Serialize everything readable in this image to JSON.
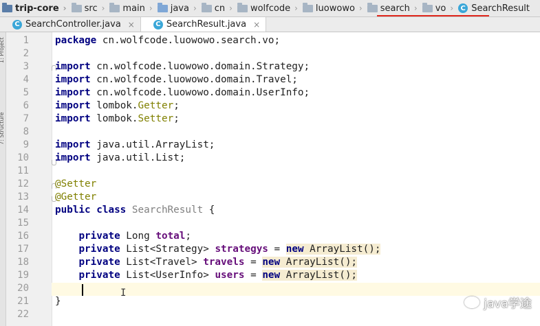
{
  "breadcrumb": {
    "items": [
      {
        "label": "trip-core",
        "icon": "project-folder-icon"
      },
      {
        "label": "src",
        "icon": "folder-icon"
      },
      {
        "label": "main",
        "icon": "folder-icon"
      },
      {
        "label": "java",
        "icon": "source-folder-icon"
      },
      {
        "label": "cn",
        "icon": "package-folder-icon"
      },
      {
        "label": "wolfcode",
        "icon": "package-folder-icon"
      },
      {
        "label": "luowowo",
        "icon": "package-folder-icon"
      },
      {
        "label": "search",
        "icon": "package-folder-icon"
      },
      {
        "label": "vo",
        "icon": "package-folder-icon"
      },
      {
        "label": "SearchResult",
        "icon": "class-icon"
      }
    ]
  },
  "tabs": [
    {
      "label": "SearchController.java",
      "icon": "class-icon",
      "close": "×",
      "active": false
    },
    {
      "label": "SearchResult.java",
      "icon": "class-icon",
      "close": "×",
      "active": true
    }
  ],
  "side_strip": {
    "project_label": "1: Project",
    "structure_label": "7: Structure"
  },
  "editor": {
    "line_numbers": [
      "1",
      "2",
      "3",
      "4",
      "5",
      "6",
      "7",
      "8",
      "9",
      "10",
      "11",
      "12",
      "13",
      "14",
      "15",
      "16",
      "17",
      "18",
      "19",
      "20",
      "21",
      "22"
    ],
    "current_line": 20,
    "code": {
      "l1": {
        "kw": "package",
        "rest": " cn.wolfcode.luowowo.search.vo;"
      },
      "l3": {
        "kw": "import",
        "rest": " cn.wolfcode.luowowo.domain.Strategy;"
      },
      "l4": {
        "kw": "import",
        "rest": " cn.wolfcode.luowowo.domain.Travel;"
      },
      "l5": {
        "kw": "import",
        "rest": " cn.wolfcode.luowowo.domain.UserInfo;"
      },
      "l6": {
        "kw": "import",
        "pre": " lombok.",
        "ann": "Getter",
        "post": ";"
      },
      "l7": {
        "kw": "import",
        "pre": " lombok.",
        "ann": "Setter",
        "post": ";"
      },
      "l9": {
        "kw": "import",
        "rest": " java.util.ArrayList;"
      },
      "l10": {
        "kw": "import",
        "rest": " java.util.List;"
      },
      "l12": {
        "ann": "@Setter"
      },
      "l13": {
        "ann": "@Getter"
      },
      "l14": {
        "kw": "public class",
        "name": " SearchResult",
        "rest": " {"
      },
      "l16": {
        "kw": "private",
        "type": " Long ",
        "field": "total",
        "rest": ";"
      },
      "l17": {
        "kw": "private",
        "type": " List<Strategy> ",
        "field": "strategys",
        "mid": " = ",
        "kw2": "new",
        "rest": " ArrayList();"
      },
      "l18": {
        "kw": "private",
        "type": " List<Travel> ",
        "field": "travels",
        "mid": " = ",
        "kw2": "new",
        "rest": " ArrayList();"
      },
      "l19": {
        "kw": "private",
        "type": " List<UserInfo> ",
        "field": "users",
        "mid": " = ",
        "kw2": "new",
        "rest": " ArrayList();"
      },
      "l21": {
        "rest": "}"
      }
    }
  },
  "watermark": {
    "text": "java学途",
    "icon": "wechat-icon"
  }
}
